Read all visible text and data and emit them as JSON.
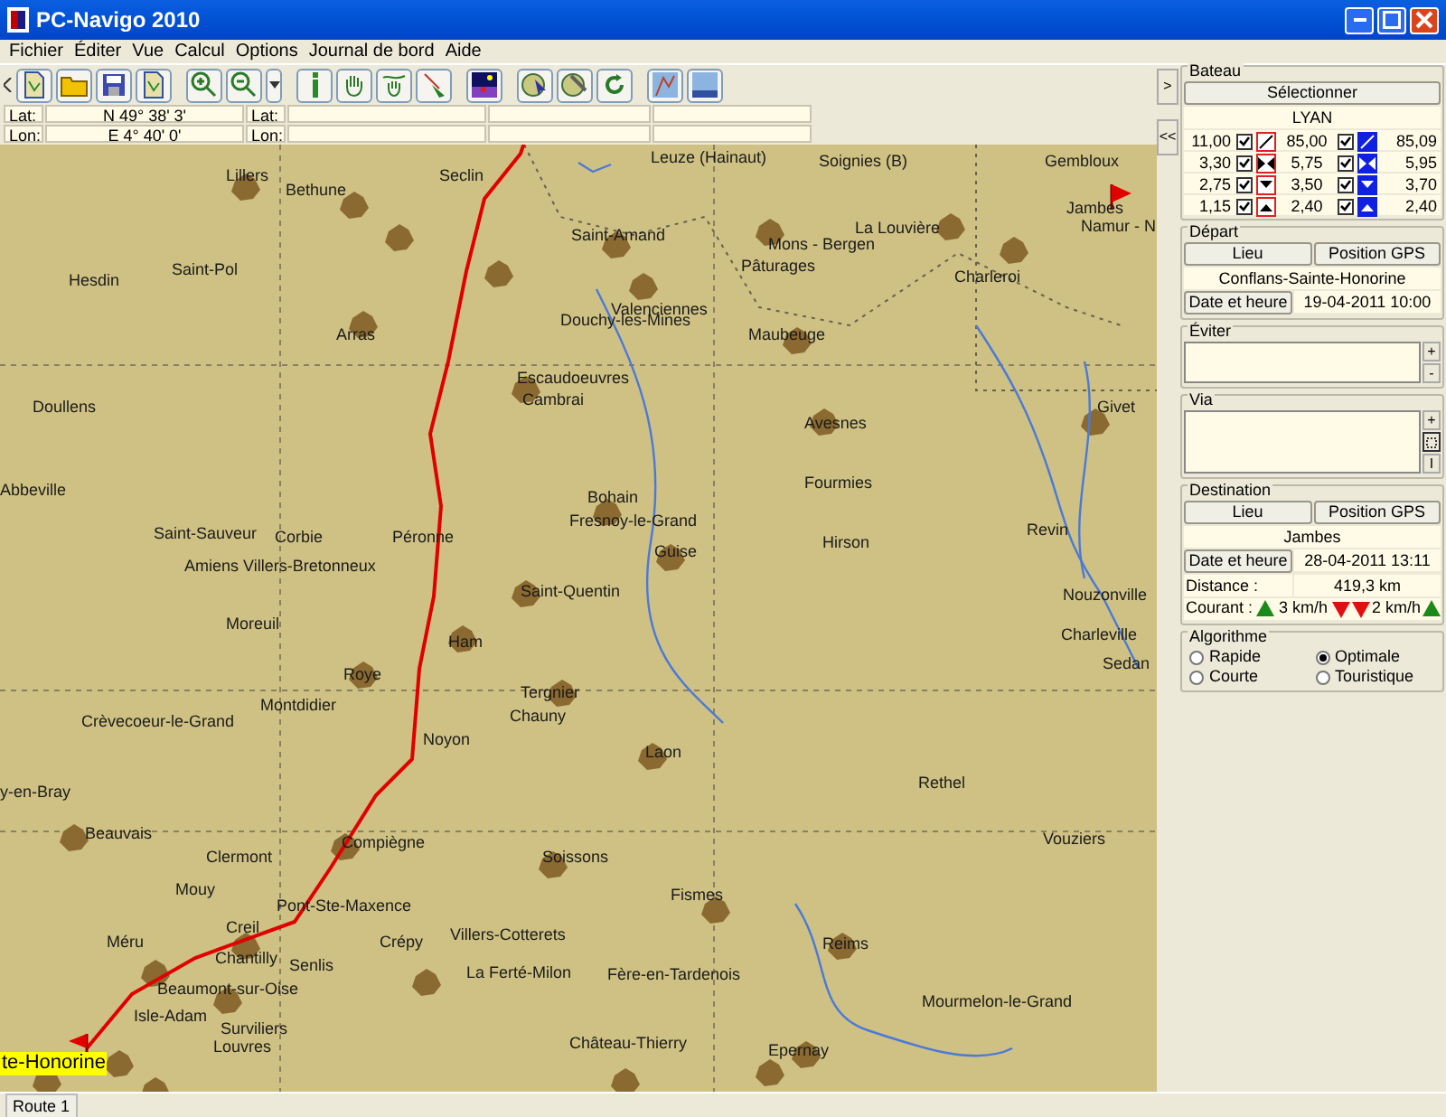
{
  "window": {
    "title": "PC-Navigo 2010"
  },
  "menu": [
    "Fichier",
    "Éditer",
    "Vue",
    "Calcul",
    "Options",
    "Journal de bord",
    "Aide"
  ],
  "coords": [
    {
      "label": "Lat:",
      "value": "N 49° 38' 3'"
    },
    {
      "label": "Lon:",
      "value": "E 4° 40' 0'"
    }
  ],
  "coords_2": [
    {
      "label": "Lat:"
    },
    {
      "label": "Lon:"
    }
  ],
  "map": {
    "places": [
      "Lillers",
      "Bethune",
      "Seclin",
      "Leuze (Hainaut)",
      "Soignies (B)",
      "Gembloux",
      "Jambes",
      "Namur - N",
      "Hesdin",
      "Saint-Pol",
      "Arras",
      "Saint-Amand",
      "Mons - Bergen",
      "La Louvière",
      "Charleroi",
      "Valenciennes",
      "Douchy-les-Mines",
      "Pâturages",
      "Maubeuge",
      "Escaudoeuvres",
      "Cambrai",
      "Doullens",
      "Abbeville",
      "Avesnes",
      "Fourmies",
      "Givet",
      "Bohain",
      "Fresnoy-le-Grand",
      "Guise",
      "Hirson",
      "Saint-Sauveur",
      "Corbie",
      "Péronne",
      "Amiens Villers-Bretonneux",
      "Saint-Quentin",
      "Revin",
      "Nouzonville",
      "Moreuil",
      "Ham",
      "Roye",
      "Montdidier",
      "Charleville",
      "Sedan",
      "Tergnier",
      "Chauny",
      "Crèvecoeur-le-Grand",
      "Noyon",
      "Laon",
      "Rethel",
      "y-en-Bray",
      "Beauvais",
      "Clermont",
      "Compiègne",
      "Soissons",
      "Vouziers",
      "Mouy",
      "Fismes",
      "Reims",
      "Pont-Ste-Maxence",
      "Creil",
      "Crépy",
      "Villers-Cotterets",
      "Chantilly",
      "Senlis",
      "Méru",
      "Beaumont-sur-Oise",
      "La Ferté-Milon",
      "Fère-en-Tardenois",
      "Surviliers",
      "Mourmelon-le-Grand",
      "Isle-Adam",
      "Louvres",
      "Château-Thierry",
      "Epernay"
    ],
    "start_label": "te-Honorine"
  },
  "panel": {
    "toggles": [
      ">",
      "<<"
    ],
    "boat": {
      "title": "Bateau",
      "select_button": "Sélectionner",
      "name": "LYAN",
      "rows": [
        {
          "a": "11,00",
          "a_checked": true,
          "b": "85,00",
          "b_checked": true,
          "c": "85,09"
        },
        {
          "a": "3,30",
          "a_checked": true,
          "b": "5,75",
          "b_checked": true,
          "c": "5,95"
        },
        {
          "a": "2,75",
          "a_checked": true,
          "b": "3,50",
          "b_checked": true,
          "c": "3,70"
        },
        {
          "a": "1,15",
          "a_checked": true,
          "b": "2,40",
          "b_checked": true,
          "c": "2,40"
        }
      ]
    },
    "departure": {
      "title": "Départ",
      "buttons": [
        "Lieu",
        "Position GPS"
      ],
      "place": "Conflans-Sainte-Honorine",
      "date_button": "Date et heure",
      "date": "19-04-2011 10:00"
    },
    "avoid": {
      "title": "Éviter",
      "buttons": [
        "+",
        "-"
      ]
    },
    "via": {
      "title": "Via",
      "buttons": [
        "+",
        "I"
      ]
    },
    "destination": {
      "title": "Destination",
      "buttons": [
        "Lieu",
        "Position GPS"
      ],
      "place": "Jambes",
      "date_button": "Date et heure",
      "date": "28-04-2011 13:11",
      "distance_label": "Distance :",
      "distance": "419,3 km",
      "current_label": "Courant :",
      "current_up": "3 km/h",
      "current_down": "2 km/h"
    },
    "algorithm": {
      "title": "Algorithme",
      "options": [
        {
          "label": "Rapide",
          "selected": false
        },
        {
          "label": "Optimale",
          "selected": true
        },
        {
          "label": "Courte",
          "selected": false
        },
        {
          "label": "Touristique",
          "selected": false
        }
      ]
    }
  },
  "status_bar": {
    "tabs": [
      "Route 1"
    ]
  }
}
